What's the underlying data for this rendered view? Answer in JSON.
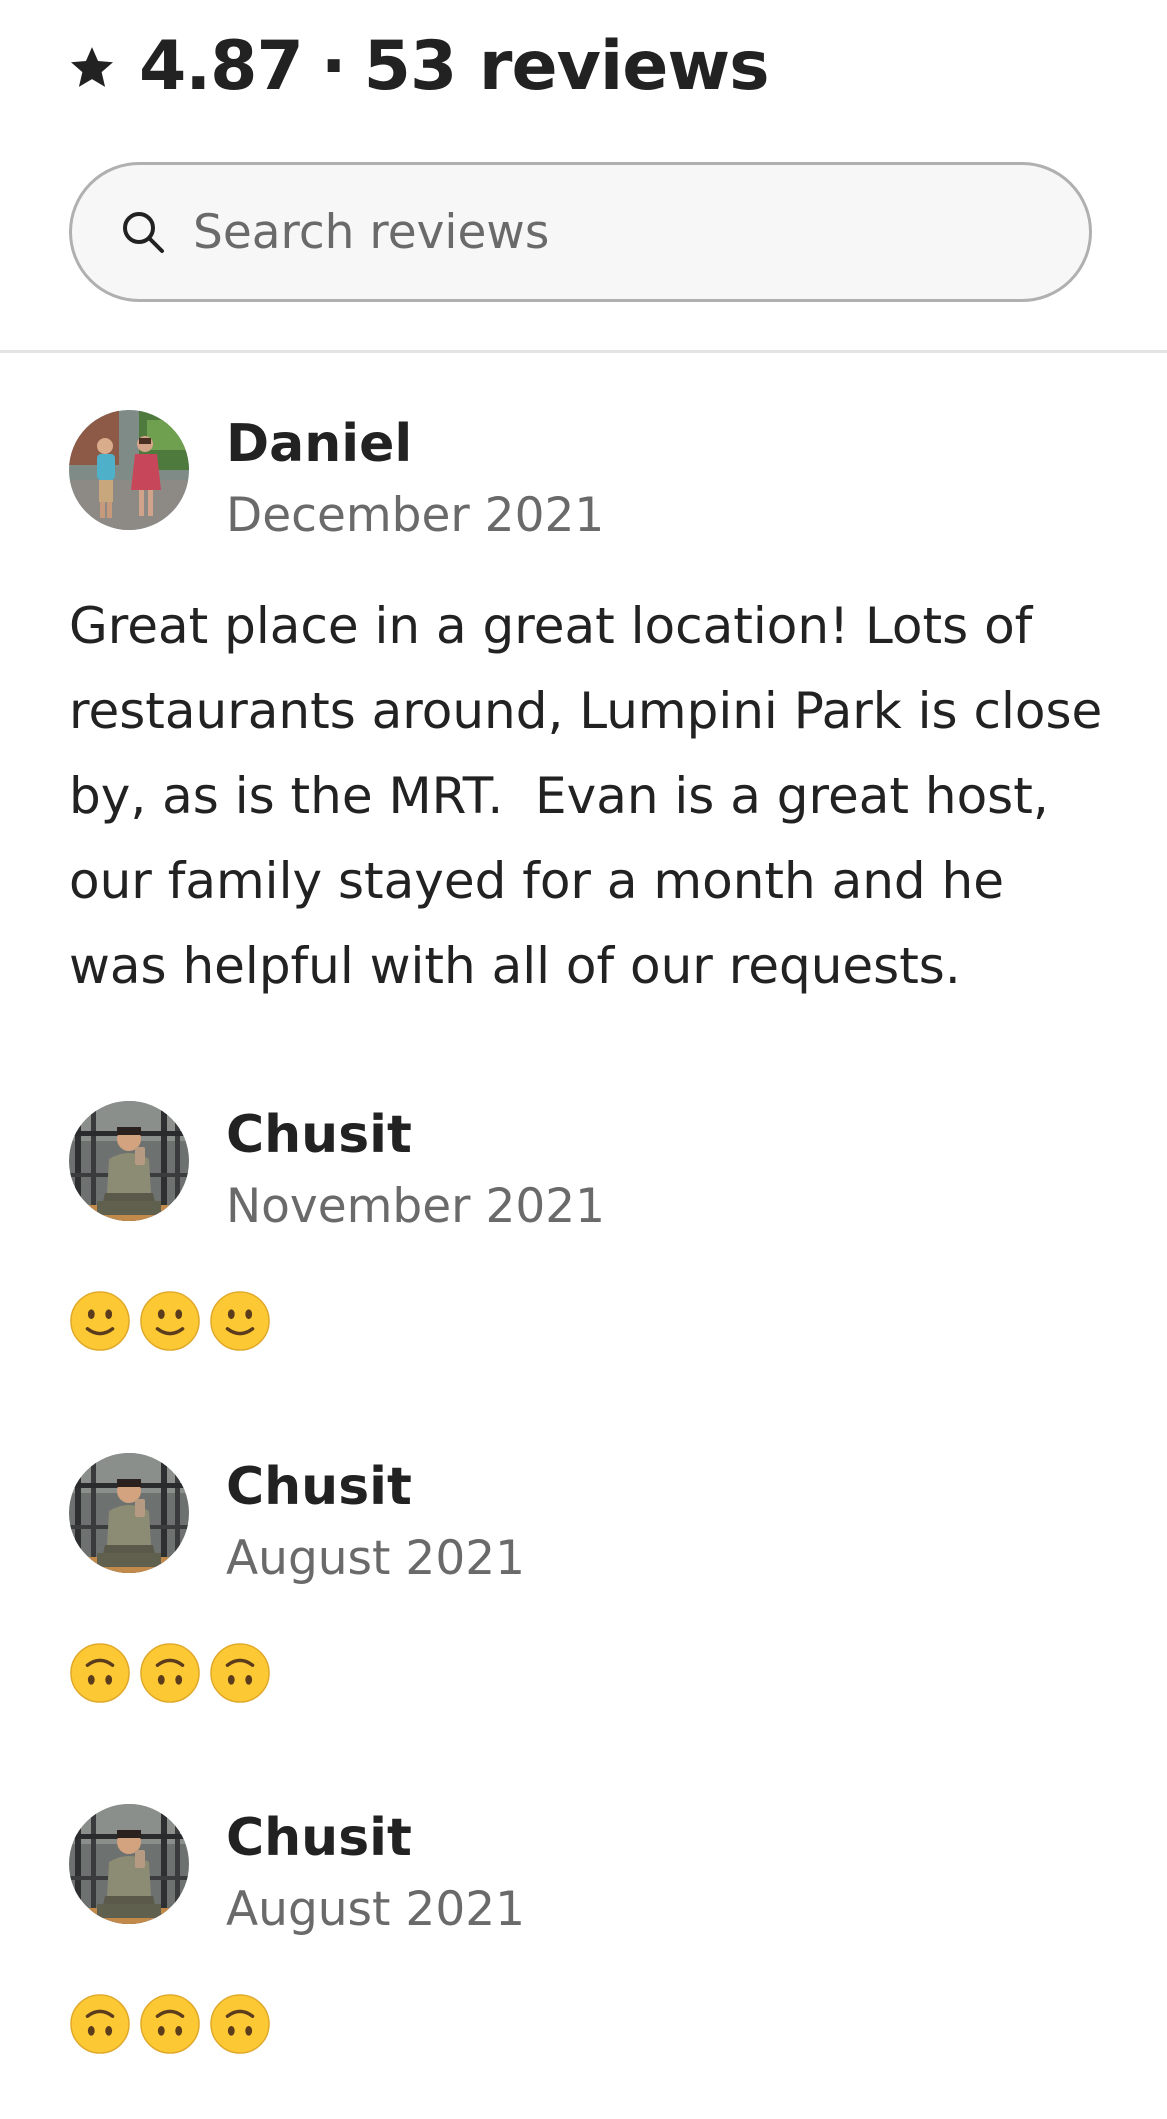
{
  "header": {
    "rating": "4.87",
    "separator": "·",
    "reviews_count": "53 reviews",
    "star_icon": "star-icon"
  },
  "search": {
    "placeholder": "Search reviews",
    "value": "",
    "icon": "search-icon"
  },
  "reviews": [
    {
      "name": "Daniel",
      "date": "December 2021",
      "text": "Great place in a great location! Lots of restaurants around, Lumpini Park is close by, as is the MRT.  Evan is a great host, our family stayed for a month and he was helpful with all of our requests.",
      "avatar": "avatar-couple-photo"
    },
    {
      "name": "Chusit",
      "date": "November 2021",
      "text": "🙂🙂🙂",
      "avatar": "avatar-gym-selfie"
    },
    {
      "name": "Chusit",
      "date": "August 2021",
      "text": "🙃🙃🙃",
      "avatar": "avatar-gym-selfie"
    },
    {
      "name": "Chusit",
      "date": "August 2021",
      "text": "🙃🙃🙃",
      "avatar": "avatar-gym-selfie"
    }
  ],
  "colors": {
    "text_primary": "#222222",
    "text_secondary": "#6a6a6a",
    "search_border": "#b0b0b0",
    "search_bg": "#f7f7f7",
    "divider": "#e4e4e4",
    "emoji_face": "#fcc934"
  }
}
